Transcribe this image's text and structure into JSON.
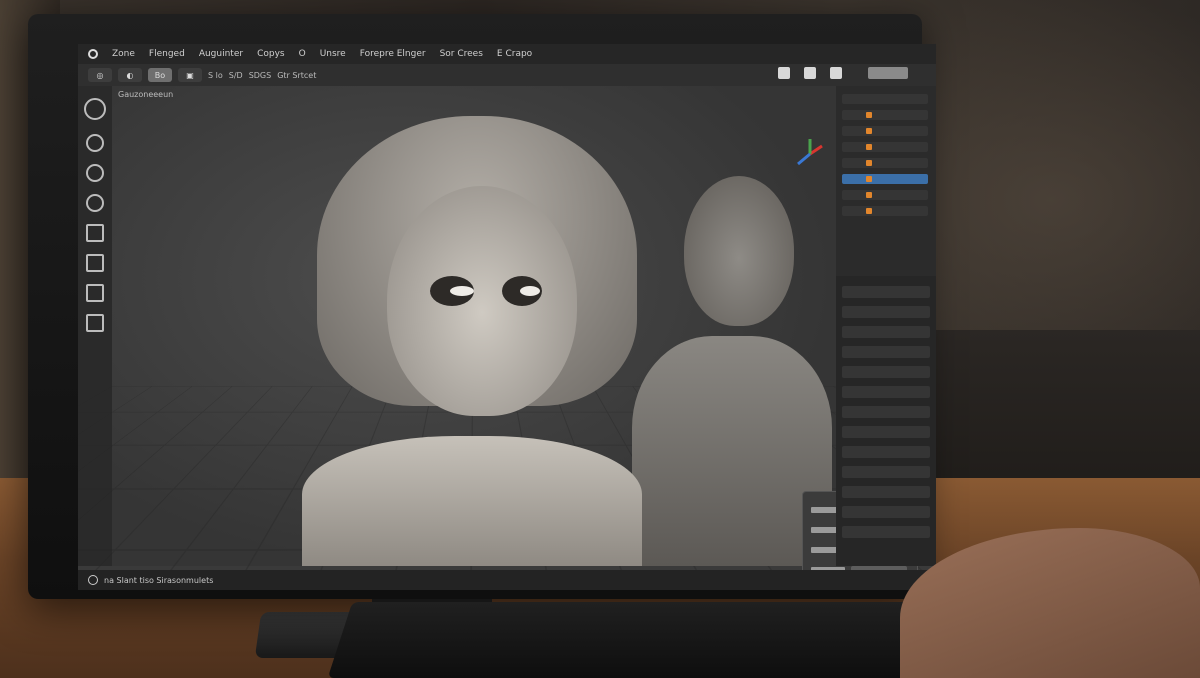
{
  "app": {
    "menu": [
      "Zone",
      "Flenged",
      "Auguinter",
      "Copys",
      "O",
      "Unsre",
      "Forepre Elnger",
      "Sor Crees",
      "E Crapo"
    ],
    "toolbar_caption": "Gauzoneeeun"
  },
  "toolbar": {
    "btn_1": "Bo",
    "btn_2": "",
    "label_1": "S lo",
    "label_2": "S/D",
    "label_3": "SDGS",
    "label_4": "Gtr Srtcet"
  },
  "status": {
    "text": "na Slant tiso Sirasonmulets"
  },
  "icons": {
    "gizmo": "axis-gizmo-icon",
    "tools": [
      "select-icon",
      "move-icon",
      "rotate-icon",
      "scale-icon",
      "sculpt-icon",
      "measure-icon",
      "grab-icon",
      "annotate-icon"
    ]
  },
  "colors": {
    "selection": "#3b6fa8",
    "object_icon": "#e2862c",
    "axis_x": "#d9352f",
    "axis_y": "#4aa34d",
    "axis_z": "#3a78d4"
  }
}
